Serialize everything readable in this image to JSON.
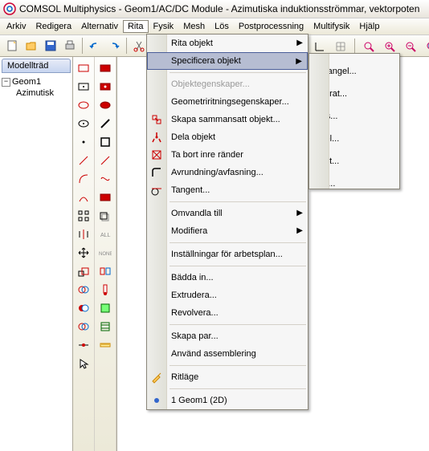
{
  "window": {
    "title": "COMSOL Multiphysics - Geom1/AC/DC Module - Azimutiska induktionsströmmar, vektorpoten"
  },
  "menubar": [
    "Arkiv",
    "Redigera",
    "Alternativ",
    "Rita",
    "Fysik",
    "Mesh",
    "Lös",
    "Postprocessning",
    "Multifysik",
    "Hjälp"
  ],
  "tree": {
    "tab": "Modellträd",
    "root": "Geom1",
    "child": "Azimutisk"
  },
  "menu": {
    "items": [
      {
        "label": "Rita objekt",
        "arrow": true
      },
      {
        "label": "Specificera objekt",
        "arrow": true,
        "hl": true
      },
      {
        "divider": true
      },
      {
        "label": "Objektegenskaper...",
        "disabled": true
      },
      {
        "label": "Geometriritningsegenskaper..."
      },
      {
        "label": "Skapa sammansatt objekt...",
        "icon": "compose"
      },
      {
        "label": "Dela objekt",
        "icon": "split"
      },
      {
        "label": "Ta bort inre ränder",
        "icon": "delint"
      },
      {
        "label": "Avrundning/avfasning...",
        "icon": "fillet"
      },
      {
        "label": "Tangent...",
        "icon": "tangent"
      },
      {
        "divider": true
      },
      {
        "label": "Omvandla till",
        "arrow": true
      },
      {
        "label": "Modifiera",
        "arrow": true
      },
      {
        "divider": true
      },
      {
        "label": "Inställningar för arbetsplan..."
      },
      {
        "divider": true
      },
      {
        "label": "Bädda in..."
      },
      {
        "label": "Extrudera..."
      },
      {
        "label": "Revolvera..."
      },
      {
        "divider": true
      },
      {
        "label": "Skapa par..."
      },
      {
        "label": "Använd assemblering"
      },
      {
        "divider": true
      },
      {
        "label": "Ritläge",
        "icon": "draw"
      },
      {
        "divider": true
      },
      {
        "label": "1 Geom1 (2D)",
        "icon": "dot"
      }
    ]
  },
  "submenu": {
    "items": [
      {
        "label": "Rektangel...",
        "icon": "rect",
        "hl": true
      },
      {
        "label": "Kvadrat...",
        "icon": "square"
      },
      {
        "label": "Ellips...",
        "icon": "ellipse"
      },
      {
        "label": "Cirkel...",
        "icon": "circle"
      },
      {
        "label": "Punkt...",
        "icon": "point"
      },
      {
        "label": "Linje...",
        "icon": "line"
      }
    ]
  }
}
